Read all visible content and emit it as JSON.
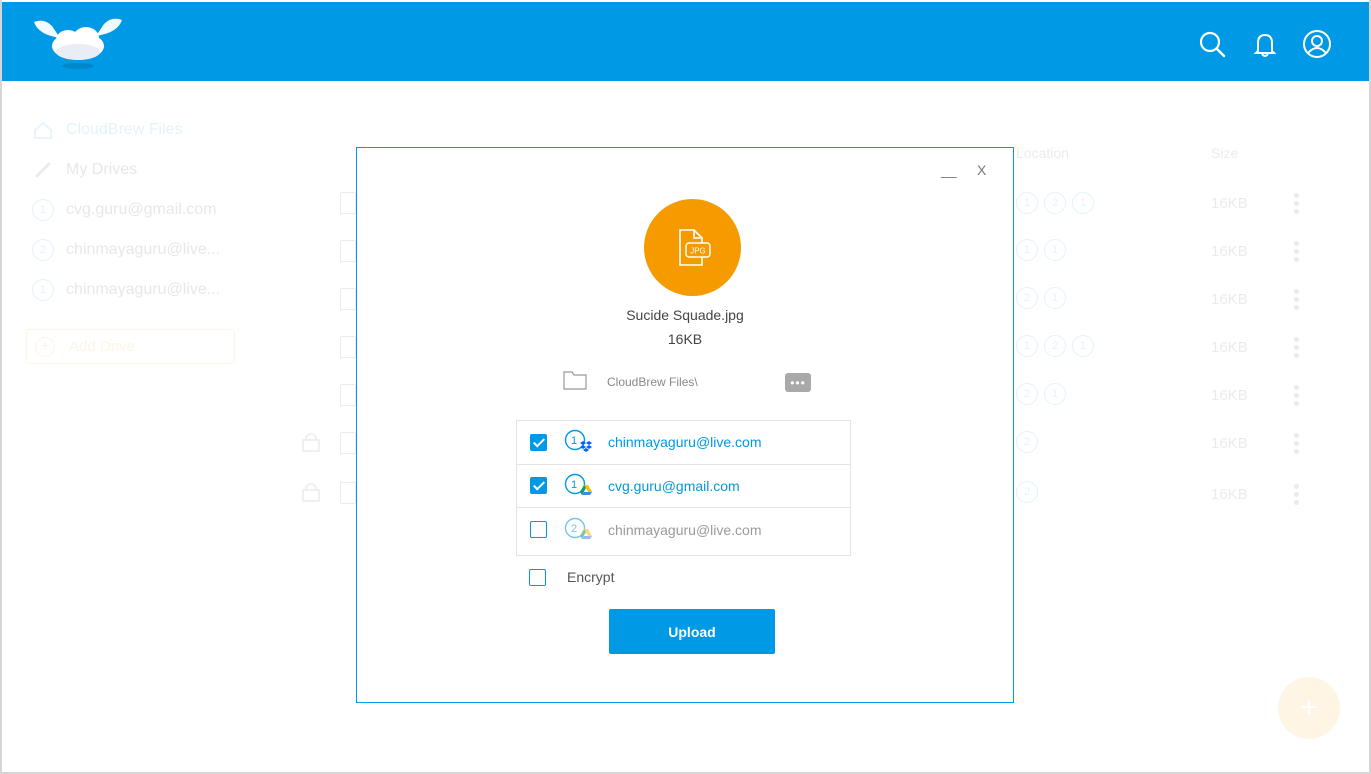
{
  "header": {
    "bg_color": "#0099e5",
    "logo": "cloudbrew-logo",
    "icons": [
      "search-icon",
      "bell-icon",
      "user-icon"
    ]
  },
  "sidebar": {
    "items": [
      {
        "label": "CloudBrew Files",
        "icon": "home-icon"
      },
      {
        "label": "My Drives",
        "icon": "link-icon"
      },
      {
        "label": "cvg.guru@gmail.com",
        "icon": "drive-1-icon"
      },
      {
        "label": "chinmayaguru@live...",
        "icon": "drive-2-icon"
      },
      {
        "label": "chinmayaguru@live...",
        "icon": "drive-1-icon"
      }
    ],
    "add_drive_label": "Add Drive"
  },
  "file_table": {
    "columns": {
      "location": "Location",
      "size": "Size"
    },
    "rows": [
      {
        "size": "16KB",
        "badges": [
          "1",
          "2",
          "1"
        ]
      },
      {
        "size": "16KB",
        "badges": [
          "1",
          "1"
        ]
      },
      {
        "size": "16KB",
        "badges": [
          "2",
          "1"
        ]
      },
      {
        "size": "16KB",
        "badges": [
          "1",
          "2",
          "1"
        ]
      },
      {
        "size": "16KB",
        "badges": [
          "2",
          "1"
        ]
      },
      {
        "size": "16KB",
        "badges": [
          "2"
        ]
      },
      {
        "size": "16KB",
        "badges": [
          "2"
        ]
      }
    ]
  },
  "dialog": {
    "minimize_label": "__",
    "close_label": "X",
    "file_type_label": "JPG",
    "file_name": "Sucide Squade.jpg",
    "file_size": "16KB",
    "folder_path": "CloudBrew Files\\",
    "browse_label": "•••",
    "accounts": [
      {
        "label": "chinmayaguru@live.com",
        "number": "1",
        "service": "dropbox",
        "checked": true
      },
      {
        "label": "cvg.guru@gmail.com",
        "number": "1",
        "service": "google-drive",
        "checked": true
      },
      {
        "label": "chinmayaguru@live.com",
        "number": "2",
        "service": "google-drive",
        "checked": false
      }
    ],
    "encrypt_label": "Encrypt",
    "encrypt_checked": false,
    "upload_label": "Upload"
  },
  "fab_label": "+"
}
